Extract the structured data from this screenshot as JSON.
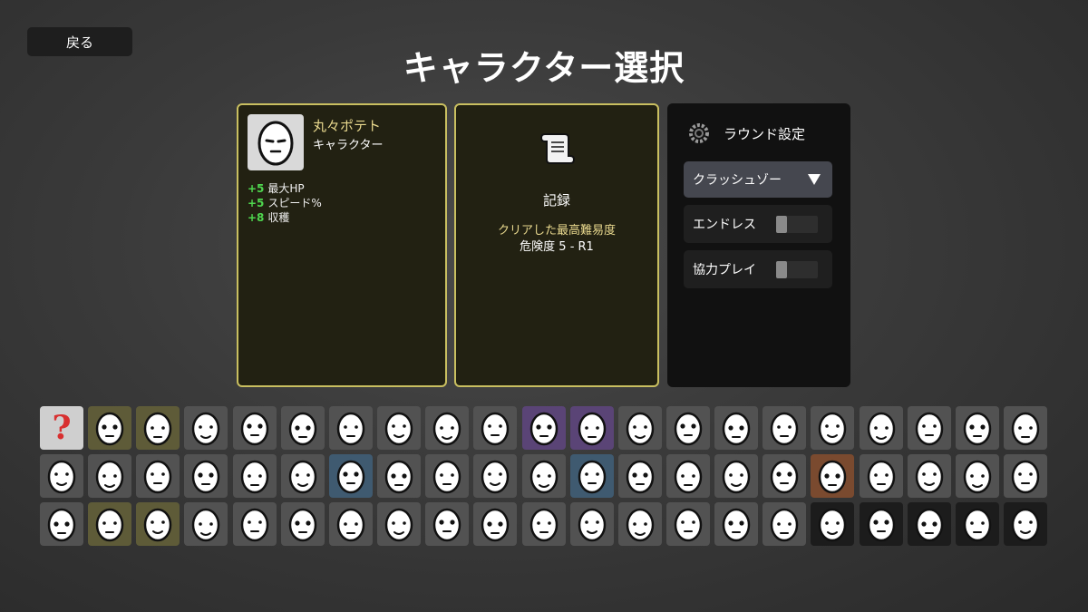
{
  "nav": {
    "back_label": "戻る"
  },
  "title": "キャラクター選択",
  "character": {
    "name": "丸々ポテト",
    "type": "キャラクター",
    "icon": "potato-face-icon",
    "stats": [
      {
        "value": "+5",
        "label": "最大HP"
      },
      {
        "value": "+5",
        "label": "スピード%"
      },
      {
        "value": "+8",
        "label": "収穫"
      }
    ]
  },
  "record": {
    "icon": "scroll-icon",
    "title": "記録",
    "label": "クリアした最高難易度",
    "value": "危険度 5 - R1"
  },
  "settings": {
    "icon": "gear-icon",
    "title": "ラウンド設定",
    "mode_selected": "クラッシュゾー",
    "toggles": [
      {
        "label": "エンドレス",
        "on": false
      },
      {
        "label": "協力プレイ",
        "on": false
      }
    ]
  },
  "colors": {
    "panel_border": "#c9bf60",
    "accent_text": "#e9d98e",
    "stat_positive": "#4fd64f",
    "random_icon": "#d83030"
  },
  "roster": {
    "rows": [
      [
        "random",
        "gold",
        "gold",
        "plain",
        "plain",
        "plain",
        "plain",
        "plain",
        "plain",
        "plain",
        "purple",
        "purple",
        "plain",
        "plain",
        "plain",
        "plain",
        "plain",
        "plain",
        "plain",
        "plain",
        "plain"
      ],
      [
        "plain",
        "plain",
        "plain",
        "plain",
        "plain",
        "plain",
        "blue",
        "plain",
        "plain",
        "plain",
        "plain",
        "blue",
        "plain",
        "plain",
        "plain",
        "plain",
        "brown",
        "plain",
        "plain",
        "plain",
        "plain"
      ],
      [
        "plain",
        "gold",
        "gold",
        "plain",
        "plain",
        "plain",
        "plain",
        "plain",
        "plain",
        "plain",
        "plain",
        "plain",
        "plain",
        "plain",
        "plain",
        "plain",
        "dark",
        "dark",
        "dark",
        "dark",
        "dark"
      ]
    ]
  }
}
